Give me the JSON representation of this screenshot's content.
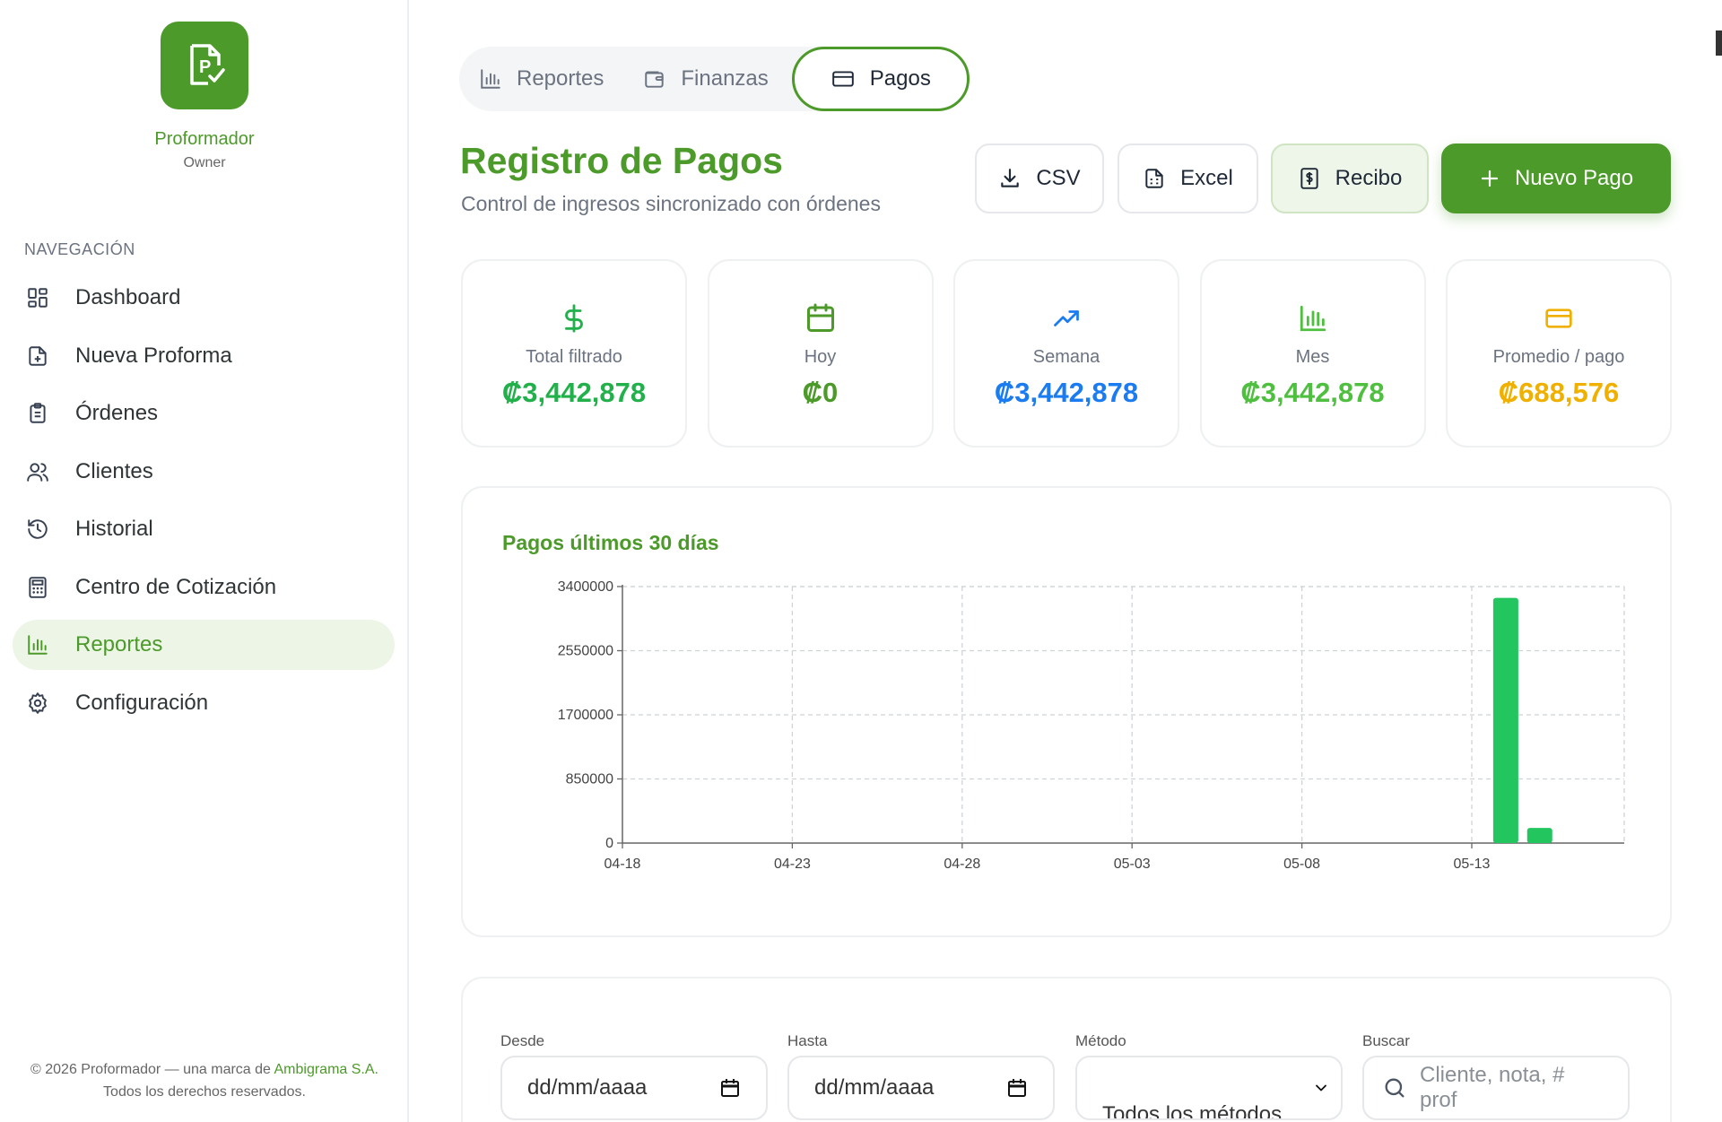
{
  "sidebar": {
    "brand_name": "Proformador",
    "brand_role": "Owner",
    "nav_title": "NAVEGACIÓN",
    "items": [
      {
        "label": "Dashboard",
        "icon": "dashboard-icon"
      },
      {
        "label": "Nueva Proforma",
        "icon": "file-plus-icon"
      },
      {
        "label": "Órdenes",
        "icon": "clipboard-icon"
      },
      {
        "label": "Clientes",
        "icon": "users-icon"
      },
      {
        "label": "Historial",
        "icon": "history-icon"
      },
      {
        "label": "Centro de Cotización",
        "icon": "calculator-icon"
      },
      {
        "label": "Reportes",
        "icon": "bar-chart-icon",
        "active": true
      },
      {
        "label": "Configuración",
        "icon": "gear-icon"
      }
    ],
    "footer": {
      "text_before": "© 2026 Proformador — una marca de ",
      "link": "Ambigrama S.A.",
      "text_after": " Todos los derechos reservados."
    }
  },
  "tabs": [
    {
      "label": "Reportes",
      "icon": "bar-chart-icon"
    },
    {
      "label": "Finanzas",
      "icon": "wallet-icon"
    },
    {
      "label": "Pagos",
      "icon": "credit-card-icon",
      "active": true
    }
  ],
  "header": {
    "title": "Registro de Pagos",
    "subtitle": "Control de ingresos sincronizado con órdenes"
  },
  "actions": {
    "csv": "CSV",
    "excel": "Excel",
    "recibo": "Recibo",
    "nuevo_pago": "Nuevo Pago"
  },
  "stats": [
    {
      "label": "Total filtrado",
      "value": "₡3,442,878",
      "icon": "dollar-icon",
      "color": "#22b04b"
    },
    {
      "label": "Hoy",
      "value": "₡0",
      "icon": "calendar-icon",
      "color": "#4c9a2a"
    },
    {
      "label": "Semana",
      "value": "₡3,442,878",
      "icon": "trending-up-icon",
      "color": "#1a7cf0"
    },
    {
      "label": "Mes",
      "value": "₡3,442,878",
      "icon": "bar-chart-icon",
      "color": "#4fbf3f"
    },
    {
      "label": "Promedio / pago",
      "value": "₡688,576",
      "icon": "credit-card-icon",
      "color": "#f0b000"
    }
  ],
  "chart_data": {
    "type": "bar",
    "title": "Pagos últimos 30 días",
    "x_tick_labels": [
      "04-18",
      "04-23",
      "04-28",
      "05-03",
      "05-08",
      "05-13"
    ],
    "y_tick_labels": [
      "0",
      "850000",
      "1700000",
      "2550000",
      "3400000"
    ],
    "ylim": [
      0,
      3400000
    ],
    "grid": true,
    "color": "#22c55e",
    "series": [
      {
        "values": [
          {
            "x": "05-14",
            "y": 3250000
          },
          {
            "x": "05-15",
            "y": 200000
          }
        ]
      }
    ]
  },
  "filters": {
    "desde_label": "Desde",
    "desde_value": "dd/mm/aaaa",
    "hasta_label": "Hasta",
    "hasta_value": "dd/mm/aaaa",
    "metodo_label": "Método",
    "metodo_value": "Todos los métodos",
    "buscar_label": "Buscar",
    "buscar_placeholder": "Cliente, nota, # prof"
  }
}
